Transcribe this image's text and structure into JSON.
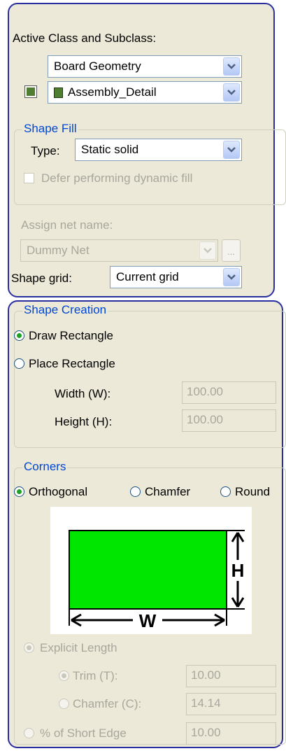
{
  "top": {
    "active_class_label": "Active Class and Subclass:",
    "class_value": "Board Geometry",
    "subclass_value": "Assembly_Detail",
    "subclass_color": "#4f7e32",
    "shape_fill_legend": "Shape Fill",
    "type_label": "Type:",
    "type_value": "Static solid",
    "defer_label": "Defer performing dynamic fill",
    "assign_net_label": "Assign net name:",
    "net_value": "Dummy Net",
    "browse_label": "...",
    "shape_grid_label": "Shape grid:",
    "grid_value": "Current grid"
  },
  "creation": {
    "legend": "Shape Creation",
    "draw_rect_label": "Draw Rectangle",
    "place_rect_label": "Place Rectangle",
    "width_label": "Width (W):",
    "width_value": "100.00",
    "height_label": "Height (H):",
    "height_value": "100.00"
  },
  "corners": {
    "legend": "Corners",
    "orthogonal_label": "Orthogonal",
    "chamfer_label": "Chamfer",
    "round_label": "Round",
    "diagram": {
      "w_label": "W",
      "h_label": "H",
      "fill": "#00e600"
    },
    "explicit_length_label": "Explicit Length",
    "trim_label": "Trim (T):",
    "trim_value": "10.00",
    "chamfer_c_label": "Chamfer (C):",
    "chamfer_c_value": "14.14",
    "short_edge_label": "% of Short Edge",
    "short_edge_value": "10.00"
  },
  "colors": {
    "accent": "#0046d5",
    "panel": "#ece9d8",
    "border": "#2a2fa0"
  }
}
